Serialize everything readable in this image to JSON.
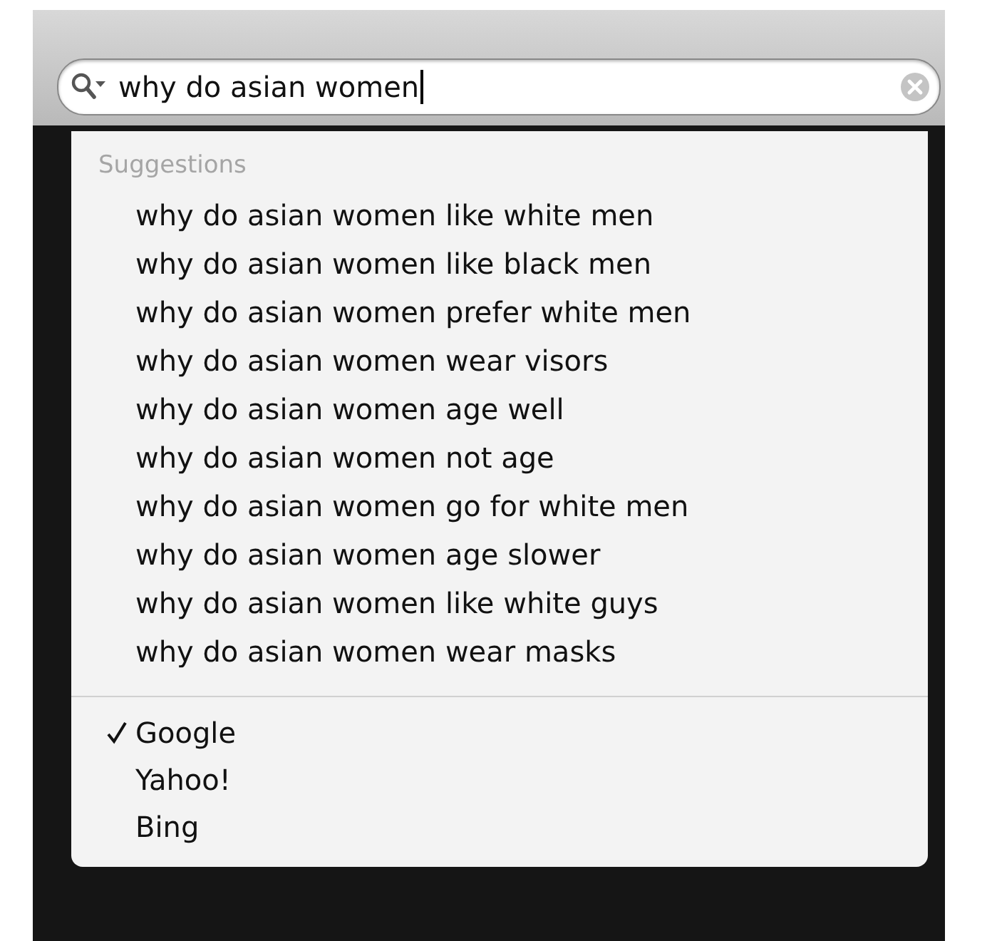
{
  "search": {
    "value": "why do asian women"
  },
  "suggestions": {
    "header": "Suggestions",
    "items": [
      "why do asian women like white men",
      "why do asian women like black men",
      "why do asian women prefer white men",
      "why do asian women wear visors",
      "why do asian women age well",
      "why do asian women not age",
      "why do asian women go for white men",
      "why do asian women age slower",
      "why do asian women like white guys",
      "why do asian women wear masks"
    ]
  },
  "engines": [
    {
      "label": "Google",
      "selected": true
    },
    {
      "label": "Yahoo!",
      "selected": false
    },
    {
      "label": "Bing",
      "selected": false
    }
  ]
}
